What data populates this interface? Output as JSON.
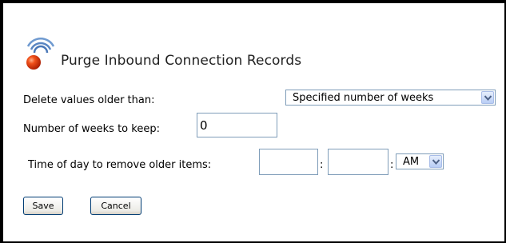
{
  "page": {
    "title": "Purge Inbound Connection Records"
  },
  "form": {
    "delete_label": "Delete values older than:",
    "delete_select": "Specified number of weeks",
    "weeks_label": "Number of weeks to keep:",
    "weeks_value": "0",
    "time_label": "Time of day to remove older items:",
    "hour_value": "",
    "minute_value": "",
    "time_sep_1": ":",
    "time_sep_2": ":",
    "ampm_select": "AM"
  },
  "buttons": {
    "save_label": "Save",
    "cancel_label": "Cancel"
  },
  "colors": {
    "icon_orb": "#e03a10",
    "icon_waves": "#4a78b8",
    "input_border": "#7f9db9",
    "button_border": "#003c74"
  },
  "icons": {
    "title_icon": "broadcast-orb-icon",
    "dropdown_arrow": "chevron-down-icon"
  }
}
